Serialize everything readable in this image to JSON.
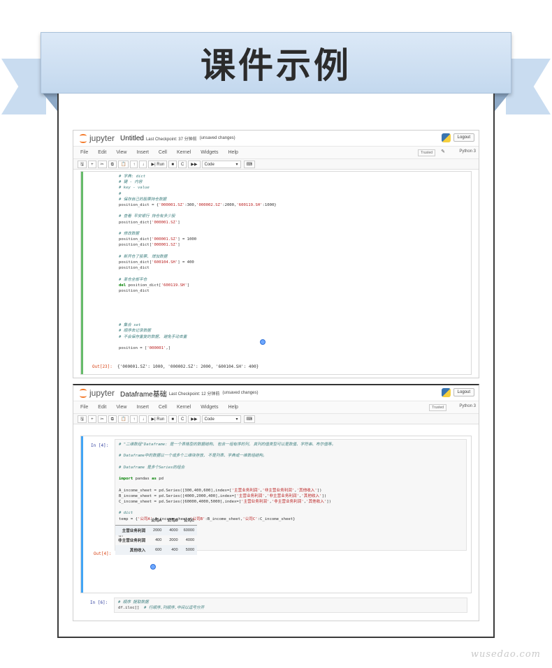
{
  "banner": {
    "title": "课件示例"
  },
  "notebook1": {
    "brand": "jupyter",
    "name": "Untitled",
    "checkpoint": "Last Checkpoint: 37 分钟前",
    "status": "(unsaved changes)",
    "logout": "Logout",
    "menus": [
      "File",
      "Edit",
      "View",
      "Insert",
      "Cell",
      "Kernel",
      "Widgets",
      "Help"
    ],
    "trusted": "Trusted",
    "kernel": "Python 3",
    "toolbar": {
      "save": "🖫",
      "add": "+",
      "cut": "✂",
      "copy": "⧉",
      "paste": "📋",
      "up": "↑",
      "down": "↓",
      "run": "▶| Run",
      "stop": "■",
      "restart": "C",
      "fast": "▶▶",
      "celltype": "Code",
      "keyboard": "⌨"
    },
    "out_prompt": "Out[23]:",
    "output": "{'000001.SZ': 1000, '000002.SZ': 2000, '600104.SH': 400}"
  },
  "notebook2": {
    "brand": "jupyter",
    "name": "Dataframe基础",
    "checkpoint": "Last Checkpoint: 12 分钟前",
    "status": "(unsaved changes)",
    "logout": "Logout",
    "menus": [
      "File",
      "Edit",
      "View",
      "Insert",
      "Cell",
      "Kernel",
      "Widgets",
      "Help"
    ],
    "trusted": "Trusted",
    "kernel": "Python 3",
    "toolbar": {
      "save": "🖫",
      "add": "+",
      "cut": "✂",
      "copy": "⧉",
      "paste": "📋",
      "up": "↑",
      "down": "↓",
      "run": "▶| Run",
      "stop": "■",
      "restart": "C",
      "fast": "▶▶",
      "celltype": "Code",
      "keyboard": "⌨"
    },
    "in4_prompt": "In [4]:",
    "out4_prompt": "Out[4]:",
    "in6_prompt": "In [6]:",
    "df": {
      "columns": [
        "公司A",
        "公司B",
        "公司C"
      ],
      "rows": [
        {
          "label": "主营业务利润",
          "a": "2000",
          "b": "4000",
          "c": "60000"
        },
        {
          "label": "非主营业务利润",
          "a": "400",
          "b": "2000",
          "c": "4000"
        },
        {
          "label": "其他收入",
          "a": "600",
          "b": "400",
          "c": "5000"
        }
      ]
    }
  },
  "watermark": "wusedao.com"
}
